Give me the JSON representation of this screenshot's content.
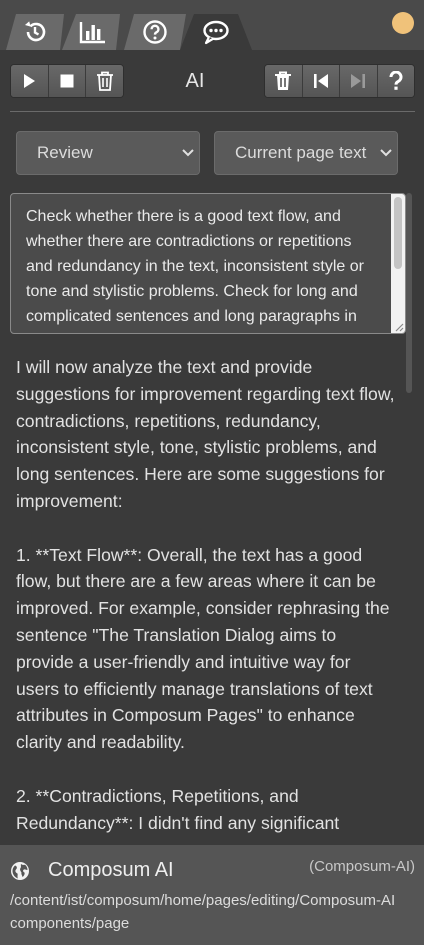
{
  "tabs": [
    {
      "icon": "history-icon",
      "active": false
    },
    {
      "icon": "bar-chart-icon",
      "active": false
    },
    {
      "icon": "help-circle-icon",
      "active": false
    },
    {
      "icon": "chat-bubble-icon",
      "active": true
    }
  ],
  "status_color": "#f0c27a",
  "toolbar": {
    "title": "AI",
    "left_buttons": [
      "play-icon",
      "stop-icon",
      "trash-icon"
    ],
    "right_buttons": [
      "trash-icon",
      "skip-back-icon",
      "skip-forward-icon",
      "question-icon"
    ]
  },
  "selects": {
    "mode": "Review",
    "source": "Current page text"
  },
  "prompt": {
    "text": "Check whether there is a good text flow, and whether there are contradictions or repetitions and redundancy in the text, inconsistent style or tone and stylistic problems. Check for long and complicated sentences and long paragraphs in the text."
  },
  "response": {
    "paragraphs": [
      "I will now analyze the text and provide suggestions for improvement regarding text flow, contradictions, repetitions, redundancy, inconsistent style, tone, stylistic problems, and long sentences. Here are some suggestions for improvement:",
      "1. **Text Flow**: Overall, the text has a good flow, but there are a few areas where it can be improved. For example, consider rephrasing the sentence \"The Translation Dialog aims to provide a user-friendly and intuitive way for users to efficiently manage translations of text attributes in Composum Pages\" to enhance clarity and readability.",
      "2. **Contradictions, Repetitions, and Redundancy**: I didn't find any significant"
    ]
  },
  "footer": {
    "name": "Composum AI",
    "tag": "(Composum-AI)",
    "path": "/content/ist/composum/home/pages/editing/Composum-AI",
    "type": "components/page"
  }
}
